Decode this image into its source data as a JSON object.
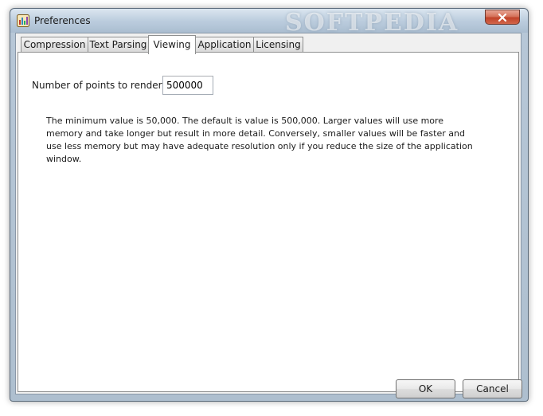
{
  "window": {
    "title": "Preferences",
    "watermark": "SOFTPEDIA"
  },
  "tabs": [
    {
      "label": "Compression",
      "active": false
    },
    {
      "label": "Text Parsing",
      "active": false
    },
    {
      "label": "Viewing",
      "active": true
    },
    {
      "label": "Application",
      "active": false
    },
    {
      "label": "Licensing",
      "active": false
    }
  ],
  "viewing": {
    "points_label": "Number of points to render",
    "points_value": "500000",
    "description": "The minimum value is 50,000. The default is value is 500,000. Larger values will use more memory and take longer but result in more detail. Conversely, smaller values will be faster and use less memory but may have adequate resolution only if you reduce the size of the application window."
  },
  "buttons": {
    "ok_label": "OK",
    "cancel_label": "Cancel"
  },
  "icons": {
    "app": "app-icon",
    "close": "close-icon"
  },
  "colors": {
    "titlebar": "#bccdde",
    "close_button": "#c1432a",
    "panel": "#ffffff"
  }
}
